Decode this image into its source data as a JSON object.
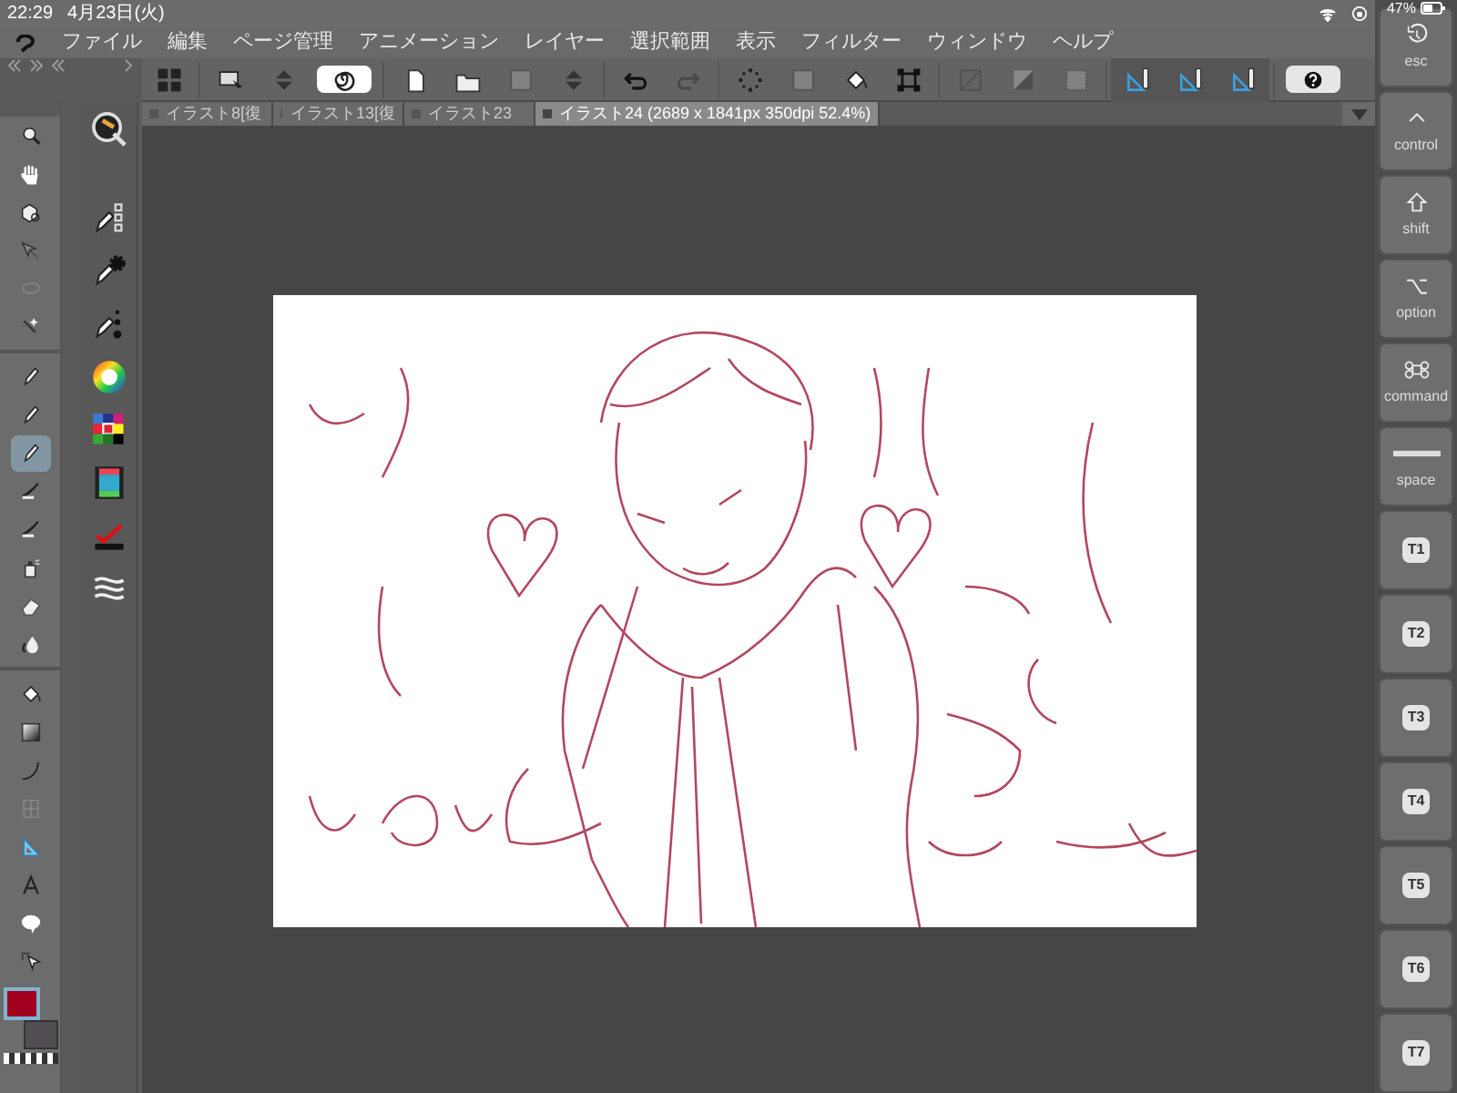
{
  "status_bar": {
    "time": "22:29",
    "date": "4月23日(火)",
    "battery": "47%"
  },
  "menu": [
    "ファイル",
    "編集",
    "ページ管理",
    "アニメーション",
    "レイヤー",
    "選択範囲",
    "表示",
    "フィルター",
    "ウィンドウ",
    "ヘルプ"
  ],
  "toolbar": [
    {
      "kind": "grid",
      "disabled": false,
      "on": false
    },
    {
      "kind": "screen",
      "disabled": false,
      "on": false
    },
    {
      "kind": "updown",
      "disabled": false,
      "on": false
    },
    {
      "kind": "spiral",
      "disabled": false,
      "on": true
    },
    {
      "kind": "page",
      "disabled": false,
      "on": false
    },
    {
      "kind": "folder",
      "disabled": false,
      "on": false
    },
    {
      "kind": "square",
      "disabled": true,
      "on": false
    },
    {
      "kind": "updown",
      "disabled": false,
      "on": false
    },
    {
      "kind": "undo",
      "disabled": false,
      "on": false
    },
    {
      "kind": "redo",
      "disabled": true,
      "on": false
    },
    {
      "kind": "dots",
      "disabled": false,
      "on": false
    },
    {
      "kind": "square",
      "disabled": true,
      "on": false
    },
    {
      "kind": "bucket",
      "disabled": false,
      "on": false
    },
    {
      "kind": "transform",
      "disabled": false,
      "on": false
    },
    {
      "kind": "slash",
      "disabled": true,
      "on": false
    },
    {
      "kind": "half",
      "disabled": true,
      "on": false
    },
    {
      "kind": "grid9",
      "disabled": true,
      "on": false
    },
    {
      "kind": "ruler",
      "disabled": false,
      "on": true
    },
    {
      "kind": "ruler",
      "disabled": false,
      "on": true
    },
    {
      "kind": "ruler",
      "disabled": false,
      "on": true
    },
    {
      "kind": "help",
      "disabled": false,
      "on": false
    }
  ],
  "tabs": [
    {
      "label": "イラスト8[復",
      "selected": false
    },
    {
      "label": "イラスト13[復",
      "selected": false
    },
    {
      "label": "イラスト23",
      "selected": false
    },
    {
      "label": "イラスト24 (2689 x 1841px 350dpi 52.4%)",
      "selected": true
    }
  ],
  "tools": [
    {
      "kind": "zoom",
      "selected": false
    },
    {
      "kind": "hand",
      "selected": false
    },
    {
      "kind": "cube",
      "selected": false
    },
    {
      "kind": "arrow",
      "selected": false
    },
    {
      "kind": "lasso",
      "selected": false
    },
    {
      "kind": "wand",
      "selected": false
    },
    {
      "kind": "pen",
      "selected": false
    },
    {
      "kind": "pen",
      "selected": false
    },
    {
      "kind": "pen",
      "selected": true
    },
    {
      "kind": "brush",
      "selected": false
    },
    {
      "kind": "brush",
      "selected": false
    },
    {
      "kind": "spray",
      "selected": false
    },
    {
      "kind": "eraser",
      "selected": false
    },
    {
      "kind": "drop",
      "selected": false
    },
    {
      "kind": "bucket",
      "selected": false
    },
    {
      "kind": "gradient",
      "selected": false
    },
    {
      "kind": "curve",
      "selected": false
    },
    {
      "kind": "frame",
      "selected": false
    },
    {
      "kind": "triangle",
      "selected": false
    },
    {
      "kind": "text",
      "selected": false
    },
    {
      "kind": "bubble",
      "selected": false
    },
    {
      "kind": "cursor",
      "selected": false
    }
  ],
  "colors": [
    {
      "kind": "main",
      "color": "#a1001f"
    },
    {
      "kind": "sub",
      "color": "#514d52"
    }
  ],
  "palette_icons": [
    {
      "kind": "navigator"
    },
    {
      "kind": "pen-squares"
    },
    {
      "kind": "pen-gear"
    },
    {
      "kind": "pen-dots"
    },
    {
      "kind": "color-wheel"
    },
    {
      "kind": "color-grid"
    },
    {
      "kind": "film"
    },
    {
      "kind": "check"
    },
    {
      "kind": "layers"
    }
  ],
  "keys": [
    {
      "kind": "esc",
      "label": "esc"
    },
    {
      "kind": "control",
      "label": "control"
    },
    {
      "kind": "shift",
      "label": "shift"
    },
    {
      "kind": "option",
      "label": "option"
    },
    {
      "kind": "command",
      "label": "command"
    },
    {
      "kind": "space",
      "label": "space"
    },
    {
      "kind": "shortcut",
      "label": "T1"
    },
    {
      "kind": "shortcut",
      "label": "T2"
    },
    {
      "kind": "shortcut",
      "label": "T3"
    },
    {
      "kind": "shortcut",
      "label": "T4"
    },
    {
      "kind": "shortcut",
      "label": "T5"
    },
    {
      "kind": "shortcut",
      "label": "T6"
    },
    {
      "kind": "shortcut",
      "label": "T7"
    }
  ]
}
